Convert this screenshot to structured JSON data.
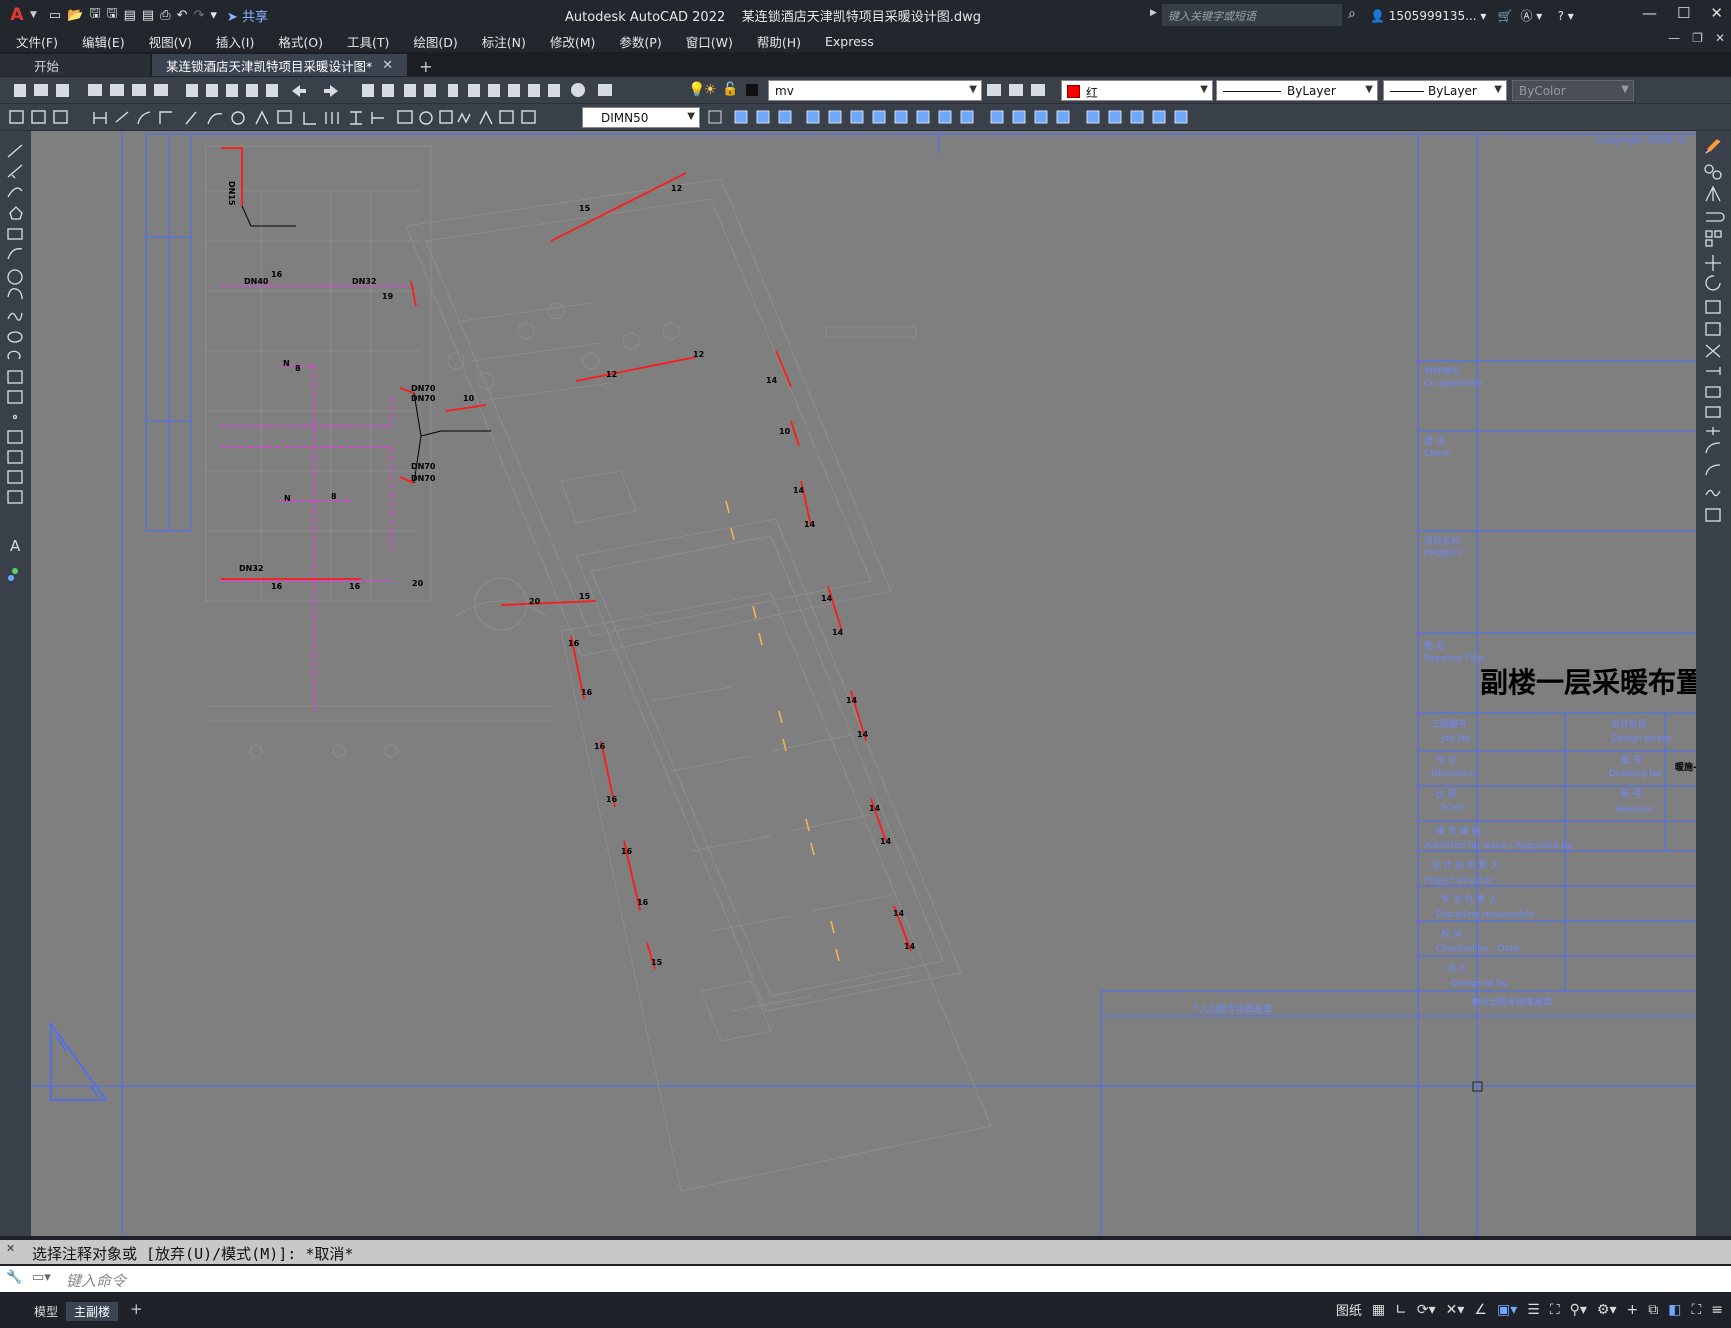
{
  "title_bar": {
    "app_title": "Autodesk AutoCAD 2022",
    "file_name": "某连锁酒店天津凯特项目采暖设计图.dwg",
    "share_label": "共享",
    "search_placeholder": "键入关键字或短语",
    "user_name": "1505999135..."
  },
  "menu": [
    "文件(F)",
    "编辑(E)",
    "视图(V)",
    "插入(I)",
    "格式(O)",
    "工具(T)",
    "绘图(D)",
    "标注(N)",
    "修改(M)",
    "参数(P)",
    "窗口(W)",
    "帮助(H)",
    "Express"
  ],
  "tabs": {
    "start": "开始",
    "document": "某连锁酒店天津凯特项目采暖设计图*"
  },
  "toolbar": {
    "layer": "mv",
    "color": "红",
    "linetype": "ByLayer",
    "lineweight": "ByLayer",
    "plotstyle": "ByColor",
    "dimstyle": "DIMN50"
  },
  "drawing": {
    "copyright": "Copyright 2006 ©",
    "drawing_title": "副楼一层采暖布置图",
    "title_block": {
      "corp_cn": "合作单位",
      "corp_en": "Co-operation",
      "client_cn": "建 设",
      "client_en": "Client",
      "project_cn": "项目名称",
      "project_en": "PROJECT",
      "drawing_cn": "图 名",
      "drawing_en": "Drawing Title",
      "jobno_cn": "工程编号",
      "jobno_en": "Job No",
      "phase_cn": "设计阶段",
      "phase_en": "Design phase",
      "disc_cn": "专 业",
      "disc_en": "Discipline",
      "dwgno_cn": "图 号",
      "dwgno_en": "Drawing No",
      "dwgno_val": "暖施-",
      "scale_cn": "比 例",
      "scale_en": "Scale",
      "rev_cn": "版 号",
      "rev_en": "Revision",
      "approved_cn": "审 定 审 核",
      "approved_en": "Admitted for issue / Approved by",
      "director_cn": "设 计 总 负 责 人",
      "director_en": "Project director",
      "respons_cn": "专 业 负 责 人",
      "respons_en": "Discipline responsible",
      "checked_cn": "校 对",
      "checked_en": "Checked by - Date",
      "designed_cn": "设 计",
      "designed_en": "Designed by",
      "stamp1": "个人出图专用章盖章",
      "stamp2": "单位出图专用章盖章"
    },
    "labels": {
      "dn15": "DN15",
      "dn40": "DN40",
      "dn32a": "DN32",
      "dn32b": "DN32",
      "dn70a": "DN70",
      "dn70b": "DN70",
      "dn70c": "DN70",
      "dn70d": "DN70",
      "n8a": "8",
      "n8b": "8",
      "nN1": "N",
      "nN2": "N",
      "n16a": "16",
      "n16b": "16",
      "n16c": "16",
      "n19": "19",
      "n10a": "10",
      "n10b": "10",
      "n20a": "20",
      "n20b": "20",
      "n15a": "15",
      "n15b": "15",
      "n12a": "12",
      "n12b": "12",
      "n12c": "12"
    }
  },
  "command": {
    "history": "选择注释对象或 [放弃(U)/模式(M)]: *取消*",
    "placeholder": "键入命令"
  },
  "status": {
    "tab_model": "模型",
    "tab_layout": "主副楼",
    "paper": "图纸"
  }
}
